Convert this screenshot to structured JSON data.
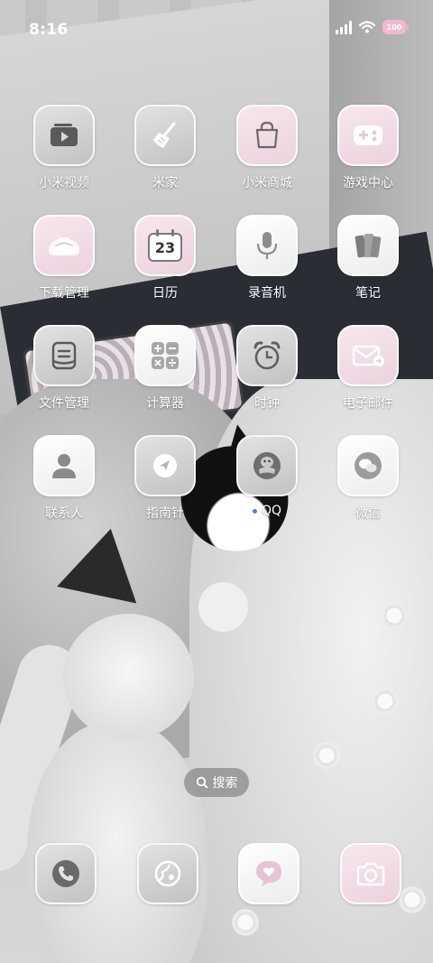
{
  "status_bar": {
    "time": "8:16",
    "battery_level": "100"
  },
  "apps": [
    {
      "label": "小米视频",
      "icon": "video-player-icon"
    },
    {
      "label": "米家",
      "icon": "broom-icon"
    },
    {
      "label": "小米商城",
      "icon": "shopping-bag-icon"
    },
    {
      "label": "游戏中心",
      "icon": "gamepad-icon"
    },
    {
      "label": "下载管理",
      "icon": "cloud-download-icon"
    },
    {
      "label": "日历",
      "icon": "calendar-icon",
      "day": "23"
    },
    {
      "label": "录音机",
      "icon": "microphone-icon"
    },
    {
      "label": "笔记",
      "icon": "notebook-icon"
    },
    {
      "label": "文件管理",
      "icon": "folder-tray-icon"
    },
    {
      "label": "计算器",
      "icon": "calculator-icon"
    },
    {
      "label": "时钟",
      "icon": "alarm-clock-icon"
    },
    {
      "label": "电子邮件",
      "icon": "envelope-icon"
    },
    {
      "label": "联系人",
      "icon": "person-icon"
    },
    {
      "label": "指南针",
      "icon": "compass-icon"
    },
    {
      "label": "QQ",
      "icon": "penguin-icon",
      "new_dot": true
    },
    {
      "label": "微信",
      "icon": "chat-bubbles-icon"
    }
  ],
  "search": {
    "label": "搜索"
  },
  "dock": [
    {
      "icon": "phone-icon"
    },
    {
      "icon": "browser-planet-icon"
    },
    {
      "icon": "message-heart-icon"
    },
    {
      "icon": "camera-icon"
    }
  ],
  "colors": {
    "pink_accent": "#ecd2de",
    "gray_tile": "#c8c8c8",
    "label_text": "#ffffff"
  }
}
